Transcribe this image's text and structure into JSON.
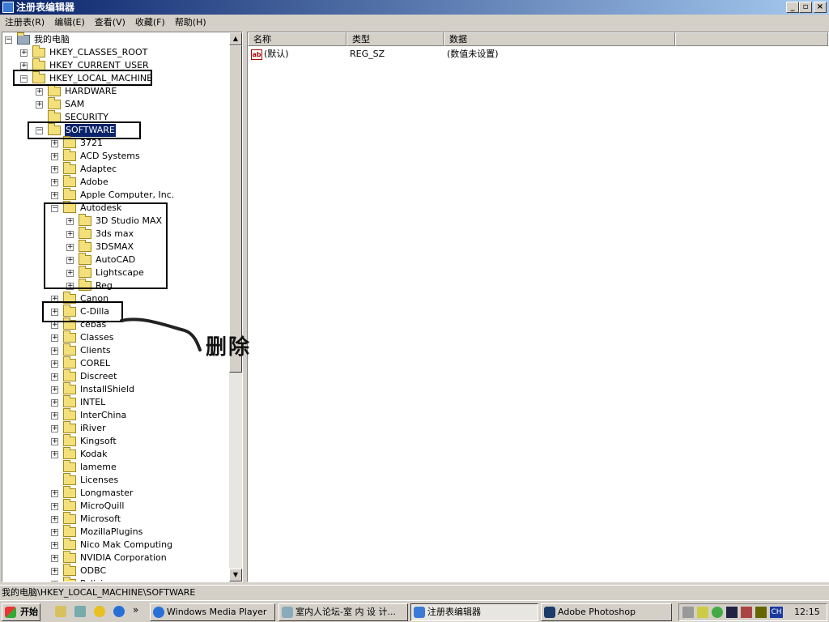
{
  "window": {
    "title": "注册表编辑器"
  },
  "menu": [
    "注册表(R)",
    "编辑(E)",
    "查看(V)",
    "收藏(F)",
    "帮助(H)"
  ],
  "tree": [
    {
      "label": "我的电脑",
      "level": 0,
      "box": "minus",
      "icon": "computer"
    },
    {
      "label": "HKEY_CLASSES_ROOT",
      "level": 1,
      "box": "plus"
    },
    {
      "label": "HKEY_CURRENT_USER",
      "level": 1,
      "box": "plus"
    },
    {
      "label": "HKEY_LOCAL_MACHINE",
      "level": 1,
      "box": "minus"
    },
    {
      "label": "HARDWARE",
      "level": 2,
      "box": "plus"
    },
    {
      "label": "SAM",
      "level": 2,
      "box": "plus"
    },
    {
      "label": "SECURITY",
      "level": 2,
      "box": "none"
    },
    {
      "label": "SOFTWARE",
      "level": 2,
      "box": "minus",
      "selected": true
    },
    {
      "label": "3721",
      "level": 3,
      "box": "plus"
    },
    {
      "label": "ACD Systems",
      "level": 3,
      "box": "plus"
    },
    {
      "label": "Adaptec",
      "level": 3,
      "box": "plus"
    },
    {
      "label": "Adobe",
      "level": 3,
      "box": "plus"
    },
    {
      "label": "Apple Computer, Inc.",
      "level": 3,
      "box": "plus"
    },
    {
      "label": "Autodesk",
      "level": 3,
      "box": "minus"
    },
    {
      "label": "3D Studio MAX",
      "level": 4,
      "box": "plus"
    },
    {
      "label": "3ds max",
      "level": 4,
      "box": "plus"
    },
    {
      "label": "3DSMAX",
      "level": 4,
      "box": "plus"
    },
    {
      "label": "AutoCAD",
      "level": 4,
      "box": "plus"
    },
    {
      "label": "Lightscape",
      "level": 4,
      "box": "plus"
    },
    {
      "label": "Reg",
      "level": 4,
      "box": "plus"
    },
    {
      "label": "Canon",
      "level": 3,
      "box": "plus"
    },
    {
      "label": "C-Dilla",
      "level": 3,
      "box": "plus"
    },
    {
      "label": "cebas",
      "level": 3,
      "box": "plus"
    },
    {
      "label": "Classes",
      "level": 3,
      "box": "plus"
    },
    {
      "label": "Clients",
      "level": 3,
      "box": "plus"
    },
    {
      "label": "COREL",
      "level": 3,
      "box": "plus"
    },
    {
      "label": "Discreet",
      "level": 3,
      "box": "plus"
    },
    {
      "label": "InstallShield",
      "level": 3,
      "box": "plus"
    },
    {
      "label": "INTEL",
      "level": 3,
      "box": "plus"
    },
    {
      "label": "InterChina",
      "level": 3,
      "box": "plus"
    },
    {
      "label": "iRiver",
      "level": 3,
      "box": "plus"
    },
    {
      "label": "Kingsoft",
      "level": 3,
      "box": "plus"
    },
    {
      "label": "Kodak",
      "level": 3,
      "box": "plus"
    },
    {
      "label": "lameme",
      "level": 3,
      "box": "none"
    },
    {
      "label": "Licenses",
      "level": 3,
      "box": "none"
    },
    {
      "label": "Longmaster",
      "level": 3,
      "box": "plus"
    },
    {
      "label": "MicroQuill",
      "level": 3,
      "box": "plus"
    },
    {
      "label": "Microsoft",
      "level": 3,
      "box": "plus"
    },
    {
      "label": "MozillaPlugins",
      "level": 3,
      "box": "plus"
    },
    {
      "label": "Nico Mak Computing",
      "level": 3,
      "box": "plus"
    },
    {
      "label": "NVIDIA Corporation",
      "level": 3,
      "box": "plus"
    },
    {
      "label": "ODBC",
      "level": 3,
      "box": "plus"
    },
    {
      "label": "Policies",
      "level": 3,
      "box": "plus"
    }
  ],
  "list": {
    "headers": [
      "名称",
      "类型",
      "数据"
    ],
    "rows": [
      {
        "name": "(默认)",
        "type": "REG_SZ",
        "data": "(数值未设置)"
      }
    ]
  },
  "annotation": {
    "text": "删除"
  },
  "status": {
    "path": "我的电脑\\HKEY_LOCAL_MACHINE\\SOFTWARE"
  },
  "taskbar": {
    "start": "开始",
    "items": [
      {
        "label": "Windows Media Player",
        "active": false
      },
      {
        "label": "室内人论坛-室 内 设 计...",
        "active": false
      },
      {
        "label": "注册表编辑器",
        "active": true
      },
      {
        "label": "Adobe Photoshop",
        "active": false
      }
    ],
    "tray_lang": "CH",
    "clock": "12:15"
  }
}
